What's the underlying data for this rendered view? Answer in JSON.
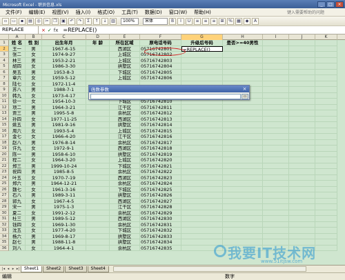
{
  "window": {
    "title": "Microsoft Excel - 职员信息.xls"
  },
  "menu": {
    "items": [
      "文件(F)",
      "编辑(E)",
      "视图(V)",
      "插入(I)",
      "格式(O)",
      "工具(T)",
      "数据(D)",
      "窗口(W)",
      "帮助(H)"
    ],
    "help_placeholder": "键入需要帮助的问题"
  },
  "toolbar": {
    "zoom": "100%",
    "font": "宋体"
  },
  "formula_bar": {
    "name_box": "REPLACE",
    "cancel": "×",
    "enter": "✓",
    "fx": "fx",
    "formula": "=REPLACE()"
  },
  "columns": [
    "A",
    "B",
    "C",
    "D",
    "E",
    "F",
    "G",
    "H",
    "I",
    "J",
    "K"
  ],
  "header_row": [
    "姓 名",
    "性 别",
    "出生年月",
    "年 龄",
    "所在区域",
    "原电话号码",
    "升级后号码",
    "是否>=40男性",
    "",
    "",
    ""
  ],
  "rows": [
    [
      "王一",
      "男",
      "1967-6-15",
      "",
      "西湖区",
      "05716742801",
      "=REPLACE()",
      ""
    ],
    [
      "张二",
      "女",
      "1974-9-27",
      "",
      "上城区",
      "05716742802",
      "",
      ""
    ],
    [
      "林三",
      "男",
      "1953-2-21",
      "",
      "上城区",
      "05716742803",
      "",
      ""
    ],
    [
      "胡四",
      "女",
      "1986-3-30",
      "",
      "拱墅区",
      "05716742804",
      "",
      ""
    ],
    [
      "吴五",
      "男",
      "1953-8-3",
      "",
      "下城区",
      "05716742805",
      "",
      ""
    ],
    [
      "章六",
      "女",
      "1959-5-12",
      "",
      "上城区",
      "05716742806",
      "",
      ""
    ],
    [
      "陆七",
      "女",
      "1972-11-4",
      "",
      "",
      "",
      "",
      ""
    ],
    [
      "苏八",
      "男",
      "1988-7-1",
      "",
      "",
      "",
      "",
      ""
    ],
    [
      "韩九",
      "女",
      "1973-4-17",
      "",
      "",
      "",
      "",
      ""
    ],
    [
      "徐一",
      "女",
      "1954-10-3",
      "",
      "下城区",
      "05716742810",
      "",
      ""
    ],
    [
      "项二",
      "男",
      "1964-3-21",
      "",
      "江干区",
      "05716742811",
      "",
      ""
    ],
    [
      "贾三",
      "男",
      "1995-5-8",
      "",
      "余杭区",
      "05716742812",
      "",
      ""
    ],
    [
      "孙四",
      "女",
      "1977-11-25",
      "",
      "西湖区",
      "05716742813",
      "",
      ""
    ],
    [
      "姚五",
      "男",
      "1981-9-16",
      "",
      "拱墅区",
      "05716742814",
      "",
      ""
    ],
    [
      "周六",
      "女",
      "1993-5-4",
      "",
      "上城区",
      "05716742815",
      "",
      ""
    ],
    [
      "金七",
      "女",
      "1966-4-20",
      "",
      "江干区",
      "05716742816",
      "",
      ""
    ],
    [
      "赵八",
      "男",
      "1976-8-14",
      "",
      "余杭区",
      "05716742817",
      "",
      ""
    ],
    [
      "许九",
      "女",
      "1972-9-1",
      "",
      "西湖区",
      "05716742818",
      "",
      ""
    ],
    [
      "陈一",
      "男",
      "1958-6-10",
      "",
      "拱墅区",
      "05716742819",
      "",
      ""
    ],
    [
      "程二",
      "女",
      "1964-3-20",
      "",
      "上城区",
      "05716742820",
      "",
      ""
    ],
    [
      "郑三",
      "男",
      "1999-10-24",
      "",
      "下城区",
      "05716742821",
      "",
      ""
    ],
    [
      "祝四",
      "男",
      "1985-8-5",
      "",
      "余杭区",
      "05716742822",
      "",
      ""
    ],
    [
      "叶五",
      "女",
      "1970-7-19",
      "",
      "西湖区",
      "05716742823",
      "",
      ""
    ],
    [
      "郑六",
      "男",
      "1964-12-21",
      "",
      "余杭区",
      "05716742824",
      "",
      ""
    ],
    [
      "魏七",
      "女",
      "1961-3-16",
      "",
      "下城区",
      "05716742825",
      "",
      ""
    ],
    [
      "石八",
      "男",
      "1989-3-11",
      "",
      "拱墅区",
      "05716742826",
      "",
      ""
    ],
    [
      "郭九",
      "女",
      "1967-4-5",
      "",
      "西湖区",
      "05716742827",
      "",
      ""
    ],
    [
      "宋一",
      "男",
      "1975-1-3",
      "",
      "江干区",
      "05716742828",
      "",
      ""
    ],
    [
      "夏二",
      "女",
      "1991-2-12",
      "",
      "余杭区",
      "05716742829",
      "",
      ""
    ],
    [
      "杜三",
      "男",
      "1989-5-12",
      "",
      "西湖区",
      "05716742830",
      "",
      ""
    ],
    [
      "钱四",
      "女",
      "1969-1-30",
      "",
      "余杭区",
      "05716742831",
      "",
      ""
    ],
    [
      "沈五",
      "女",
      "1977-4-20",
      "",
      "下城区",
      "05716742832",
      "",
      ""
    ],
    [
      "杨六",
      "男",
      "1969-8-17",
      "",
      "拱墅区",
      "05716742833",
      "",
      ""
    ],
    [
      "赵七",
      "男",
      "1988-11-8",
      "",
      "拱墅区",
      "05716742834",
      "",
      ""
    ],
    [
      "刘八",
      "女",
      "1964-4-1",
      "",
      "余杭区",
      "05716742835",
      "",
      ""
    ]
  ],
  "dialog": {
    "title": "函数参数",
    "close": "×"
  },
  "sheets": [
    "Sheet1",
    "Sheet2",
    "Sheet3",
    "Sheet4"
  ],
  "status": {
    "left": "编辑",
    "mid": "数字"
  },
  "watermark": {
    "text": "我要IT技术网",
    "url": "www.51itjsw.com"
  }
}
